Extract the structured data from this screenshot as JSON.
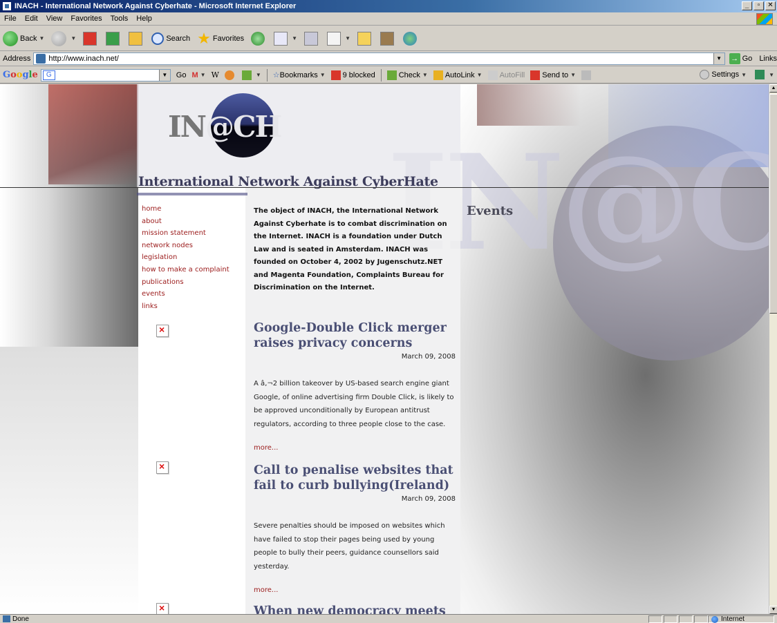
{
  "window": {
    "title": "INACH - International Network Against Cyberhate - Microsoft Internet Explorer",
    "buttons": [
      "_",
      "▫",
      "✕"
    ]
  },
  "menu": [
    "File",
    "Edit",
    "View",
    "Favorites",
    "Tools",
    "Help"
  ],
  "toolbar": {
    "back": "Back",
    "search": "Search",
    "favorites": "Favorites"
  },
  "address": {
    "label": "Address",
    "url": "http://www.inach.net/",
    "go": "Go",
    "links": "Links"
  },
  "google_bar": {
    "logo": "Google",
    "go": "Go",
    "bookmarks": "Bookmarks",
    "blocked": "9 blocked",
    "check": "Check",
    "autolink": "AutoLink",
    "autofill": "AutoFill",
    "send_to": "Send to",
    "settings": "Settings"
  },
  "page": {
    "logo_part1": "IN",
    "logo_part2": "@CH",
    "site_title": "International Network Against CyberHate",
    "watermark": "IN@CH",
    "nav": [
      "home",
      "about",
      "mission statement",
      "network nodes",
      "legislation",
      "how to make a complaint",
      "publications",
      "events",
      "links"
    ],
    "intro": "The object of INACH, the International Network Against Cyberhate is to combat discrimination on the Internet. INACH is a foundation under Dutch Law and is seated in Amsterdam. INACH was founded on October 4, 2002 by Jugenschutz.NET and Magenta Foundation, Complaints Bureau for Discrimination on the Internet.",
    "events_heading": "Events",
    "news": [
      {
        "title": "Google-Double Click merger raises privacy concerns",
        "date": "March 09, 2008",
        "body": "A â‚¬2 billion takeover by US-based search engine giant Google, of online advertising firm Double Click, is likely to be approved unconditionally by European antitrust regulators, according to three people close to the case.",
        "more": "more..."
      },
      {
        "title": "Call to penalise websites that fail to curb bullying(Ireland)",
        "date": "March 09, 2008",
        "body": "Severe penalties should be imposed on websites which have failed to stop their pages being used by young people to bully their peers, guidance counsellors said yesterday.",
        "more": "more..."
      },
      {
        "title": "When new democracy meets"
      }
    ]
  },
  "status": {
    "text": "Done",
    "zone": "Internet"
  }
}
